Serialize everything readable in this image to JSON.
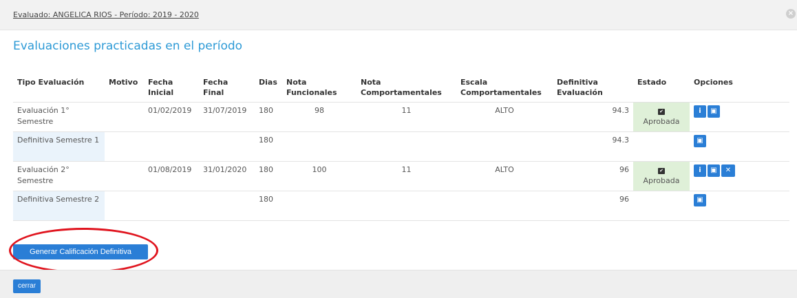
{
  "header": {
    "title": "Evaluado: ANGELICA RIOS - Período: 2019 - 2020"
  },
  "section_title": "Evaluaciones practicadas en el período",
  "table": {
    "headers": {
      "tipo": "Tipo Evaluación",
      "motivo": "Motivo",
      "fecha_inicial": "Fecha Inicial",
      "fecha_final": "Fecha Final",
      "dias": "Dias",
      "nota_funcionales": "Nota Funcionales",
      "nota_comportamentales": "Nota Comportamentales",
      "escala": "Escala Comportamentales",
      "definitiva": "Definitiva Evaluación",
      "estado": "Estado",
      "opciones": "Opciones"
    },
    "rows": [
      {
        "tipo": "Evaluación 1° Semestre",
        "motivo": "",
        "fecha_inicial": "01/02/2019",
        "fecha_final": "31/07/2019",
        "dias": "180",
        "nota_funcionales": "98",
        "nota_comportamentales": "11",
        "escala": "ALTO",
        "definitiva": "94.3",
        "estado": "Aprobada"
      },
      {
        "tipo": "Definitiva Semestre 1",
        "motivo": "",
        "fecha_inicial": "",
        "fecha_final": "",
        "dias": "180",
        "nota_funcionales": "",
        "nota_comportamentales": "",
        "escala": "",
        "definitiva": "94.3",
        "estado": ""
      },
      {
        "tipo": "Evaluación 2° Semestre",
        "motivo": "",
        "fecha_inicial": "01/08/2019",
        "fecha_final": "31/01/2020",
        "dias": "180",
        "nota_funcionales": "100",
        "nota_comportamentales": "11",
        "escala": "ALTO",
        "definitiva": "96",
        "estado": "Aprobada"
      },
      {
        "tipo": "Definitiva Semestre 2",
        "motivo": "",
        "fecha_inicial": "",
        "fecha_final": "",
        "dias": "180",
        "nota_funcionales": "",
        "nota_comportamentales": "",
        "escala": "",
        "definitiva": "96",
        "estado": ""
      }
    ]
  },
  "icons": {
    "close": "close-icon",
    "check": "check-square-icon",
    "info": "info-icon",
    "pdf": "file-pdf-icon",
    "delete": "times-icon"
  },
  "buttons": {
    "generar": "Generar Calificación Definitiva",
    "cerrar": "cerrar"
  },
  "colors": {
    "accent": "#2a7ed6",
    "title": "#2d9ad6",
    "approved_bg": "#dff0d8",
    "highlight_ellipse": "#e0141e"
  }
}
